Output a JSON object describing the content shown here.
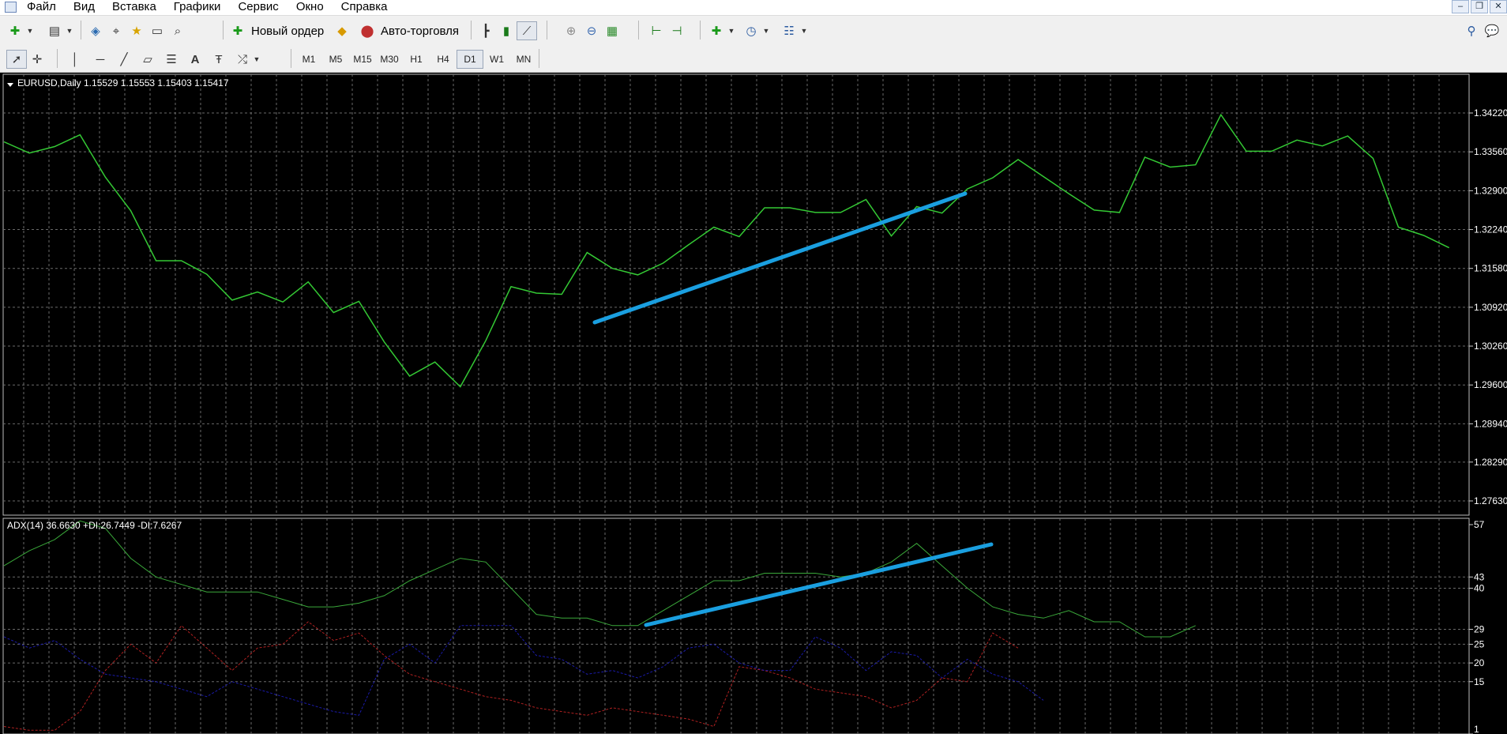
{
  "menu": [
    "Файл",
    "Вид",
    "Вставка",
    "Графики",
    "Сервис",
    "Окно",
    "Справка"
  ],
  "window_controls": [
    "‒",
    "❐",
    "✕"
  ],
  "toolbar": {
    "new_order_label": "Новый ордер",
    "auto_trading_label": "Авто-торговля"
  },
  "timeframes": [
    "M1",
    "M5",
    "M15",
    "M30",
    "H1",
    "H4",
    "D1",
    "W1",
    "MN"
  ],
  "active_timeframe": "D1",
  "price_chart": {
    "label": "EURUSD,Daily  1.15529 1.15553 1.15403 1.15417",
    "y_ticks": [
      "1.34220",
      "1.33560",
      "1.32900",
      "1.32240",
      "1.31580",
      "1.30920",
      "1.30260",
      "1.29600",
      "1.28940",
      "1.28290",
      "1.27630"
    ]
  },
  "adx_chart": {
    "label": "ADX(14) 36.6630 +DI:26.7449 -DI:7.6267",
    "y_ticks": [
      "57",
      "43",
      "40",
      "29",
      "25",
      "20",
      "15",
      "1"
    ]
  },
  "colors": {
    "price_line": "#34c934",
    "trendline": "#1a9fe0",
    "adx_line": "#3aa83a",
    "plus_di": "#1a1aa8",
    "minus_di": "#b02020",
    "grid": "#6a6a6a"
  },
  "chart_data": [
    {
      "type": "line",
      "title": "EURUSD,Daily",
      "ylim": [
        1.2763,
        1.3422
      ],
      "series": [
        {
          "name": "",
          "values": [
            1.3373,
            1.3354,
            1.3365,
            1.3385,
            1.3313,
            1.3256,
            1.3171,
            1.3171,
            1.3148,
            1.3104,
            1.3118,
            1.3101,
            1.3135,
            1.3083,
            1.3102,
            1.3033,
            1.2975,
            1.2999,
            1.2957,
            1.3035,
            1.3127,
            1.3116,
            1.3114,
            1.3185,
            1.3158,
            1.3147,
            1.3167,
            1.3198,
            1.3228,
            1.3212,
            1.3261,
            1.3261,
            1.3253,
            1.3253,
            1.3275,
            1.3213,
            1.3263,
            1.3252,
            1.3293,
            1.3312,
            1.3343,
            1.3314,
            1.3285,
            1.3257,
            1.3253,
            1.3347,
            1.333,
            1.3334,
            1.3419,
            1.3357,
            1.3357,
            1.3376,
            1.3366,
            1.3383,
            1.3345,
            1.3228,
            1.3214,
            1.3193
          ]
        }
      ]
    },
    {
      "type": "line",
      "title": "ADX(14)",
      "ylim": [
        1,
        57
      ],
      "series": [
        {
          "name": "ADX",
          "values": [
            46,
            50,
            53,
            58,
            56,
            48,
            43,
            41,
            39,
            39,
            39,
            37,
            35,
            35,
            36,
            38,
            42,
            45,
            48,
            47,
            40,
            33,
            32,
            32,
            30,
            30,
            34,
            38,
            42,
            42,
            44,
            44,
            44,
            43,
            44,
            47,
            52,
            46,
            40,
            35,
            33,
            32,
            34,
            31,
            31,
            27,
            27,
            30
          ]
        },
        {
          "name": "+DI",
          "values": [
            27,
            24,
            26,
            21,
            17,
            16,
            15,
            13,
            11,
            15,
            13,
            11,
            9,
            7,
            6,
            21,
            25,
            20,
            30,
            30,
            30,
            22,
            21,
            17,
            18,
            16,
            19,
            24,
            25,
            20,
            18,
            18,
            27,
            24,
            18,
            23,
            22,
            16,
            21,
            17,
            15,
            10
          ]
        },
        {
          "name": "-DI",
          "values": [
            3,
            2,
            2,
            7,
            18,
            25,
            20,
            30,
            24,
            18,
            24,
            25,
            31,
            26,
            28,
            22,
            17,
            15,
            13,
            11,
            10,
            8,
            7,
            6,
            8,
            7,
            6,
            5,
            3,
            19,
            18,
            16,
            13,
            12,
            11,
            8,
            10,
            16,
            15,
            28,
            24
          ]
        }
      ]
    }
  ]
}
